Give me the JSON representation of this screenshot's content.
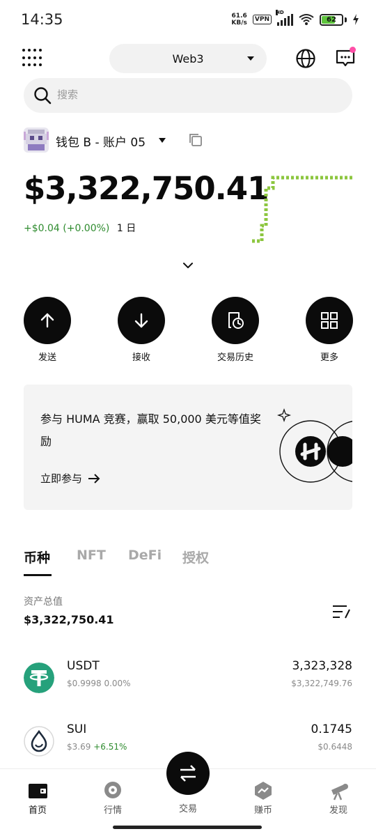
{
  "status_bar": {
    "time": "14:35",
    "net_speed_value": "61.6",
    "net_speed_unit": "KB/s",
    "vpn": "VPN",
    "hd": "HD",
    "battery": "62",
    "battery_level": 0.62
  },
  "header": {
    "network_selector": "Web3"
  },
  "search": {
    "placeholder": "搜索"
  },
  "account": {
    "name": "钱包 B - 账户 05",
    "balance": "$3,322,750.41",
    "change": "+$0.04 (+0.00%)",
    "period": "1 日"
  },
  "actions": [
    {
      "label": "发送",
      "icon": "arrow-up-icon"
    },
    {
      "label": "接收",
      "icon": "arrow-down-icon"
    },
    {
      "label": "交易历史",
      "icon": "history-icon"
    },
    {
      "label": "更多",
      "icon": "grid-icon"
    }
  ],
  "promo": {
    "title": "参与 HUMA 竞赛，赢取 50,000 美元等值奖励",
    "cta": "立即参与"
  },
  "tabs": [
    "币种",
    "NFT",
    "DeFi",
    "授权"
  ],
  "assets": {
    "total_label": "资产总值",
    "total_value": "$3,322,750.41"
  },
  "tokens": [
    {
      "symbol": "USDT",
      "price": "$0.9998",
      "change": "0.00%",
      "amount": "3,323,328",
      "value": "$3,322,749.76",
      "color": "#26a17b"
    },
    {
      "symbol": "SUI",
      "price": "$3.69",
      "change": "+6.51%",
      "amount": "0.1745",
      "value": "$0.6448",
      "color": "#4da2ff"
    }
  ],
  "bottom_nav": [
    {
      "label": "首页",
      "icon": "wallet-icon"
    },
    {
      "label": "行情",
      "icon": "market-icon"
    },
    {
      "label": "交易",
      "icon": "swap-icon"
    },
    {
      "label": "赚币",
      "icon": "earn-icon"
    },
    {
      "label": "发现",
      "icon": "discover-icon"
    }
  ],
  "colors": {
    "positive": "#2e8b2e",
    "sparkline": "#8cc63f",
    "notification_dot": "#ff4fa7"
  }
}
